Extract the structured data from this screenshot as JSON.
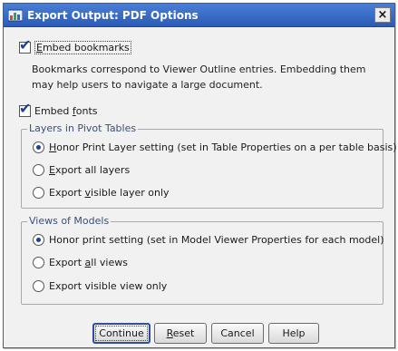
{
  "window": {
    "title": "Export Output: PDF Options",
    "close_label": "×"
  },
  "options": {
    "embed_bookmarks": {
      "label_first": "E",
      "label_rest": "mbed bookmarks",
      "checked": true
    },
    "bookmarks_description": "Bookmarks correspond to Viewer Outline entries. Embedding them may help users to navigate a large document.",
    "embed_fonts": {
      "label_before": "Embed ",
      "label_underline": "f",
      "label_after": "onts",
      "checked": true
    }
  },
  "layers_group": {
    "title": "Layers in Pivot Tables",
    "options": [
      {
        "pre": "",
        "ul": "H",
        "post": "onor Print Layer setting (set in Table Properties on a per table basis)",
        "selected": true
      },
      {
        "pre": "",
        "ul": "E",
        "post": "xport all layers",
        "selected": false
      },
      {
        "pre": "Export ",
        "ul": "v",
        "post": "isible layer only",
        "selected": false
      }
    ]
  },
  "views_group": {
    "title": "Views of Models",
    "options": [
      {
        "pre": "Honor print setting (set in Model Viewer Properties for each model)",
        "ul": "",
        "post": "",
        "selected": true
      },
      {
        "pre": "Export ",
        "ul": "a",
        "post": "ll views",
        "selected": false
      },
      {
        "pre": "Export visible view only",
        "ul": "",
        "post": "",
        "selected": false
      }
    ]
  },
  "buttons": {
    "continue": "Continue",
    "reset_ul": "R",
    "reset_rest": "eset",
    "cancel": "Cancel",
    "help": "Help"
  },
  "colors": {
    "titlebar": "#2a5bb8",
    "check_mark": "#1b3f9a",
    "group_title": "#3b4f7a"
  }
}
